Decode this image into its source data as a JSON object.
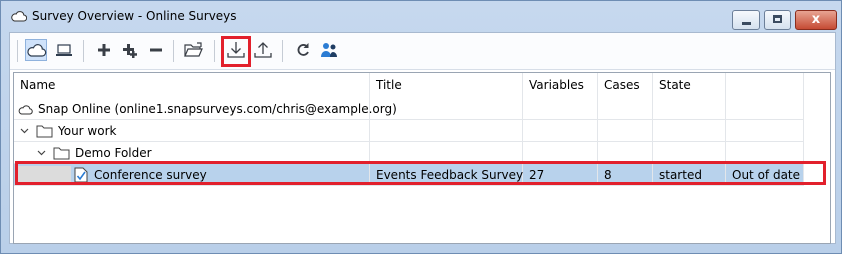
{
  "window": {
    "title": "Survey Overview - Online Surveys",
    "controls": {
      "close_label": "x"
    }
  },
  "toolbar": {
    "buttons": [
      "cloud-view-icon",
      "computer-view-icon",
      "add-icon",
      "add-multiple-icon",
      "remove-icon",
      "open-folder-icon",
      "download-icon",
      "upload-icon",
      "refresh-icon",
      "users-icon"
    ]
  },
  "grid": {
    "columns": [
      "Name",
      "Title",
      "Variables",
      "Cases",
      "State",
      ""
    ],
    "rows": [
      {
        "name": "Snap Online (online1.snapsurveys.com/chris@example.org)",
        "title": "",
        "variables": "",
        "cases": "",
        "state": "",
        "extra": ""
      },
      {
        "name": "Your work",
        "title": "",
        "variables": "",
        "cases": "",
        "state": "",
        "extra": ""
      },
      {
        "name": "Demo Folder",
        "title": "",
        "variables": "",
        "cases": "",
        "state": "",
        "extra": ""
      },
      {
        "name": "Conference survey",
        "title": "Events Feedback Survey",
        "variables": "27",
        "cases": "8",
        "state": "started",
        "extra": "Out of date"
      }
    ]
  },
  "colors": {
    "highlight": "#e2202c",
    "selection": "#b8d2ec",
    "accent": "#2b7cd3"
  }
}
